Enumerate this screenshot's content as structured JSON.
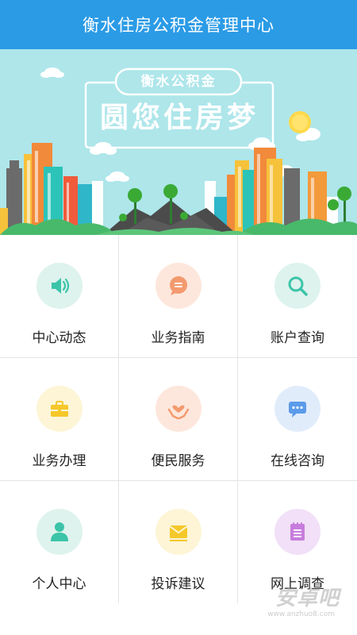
{
  "header": {
    "title": "衡水住房公积金管理中心"
  },
  "banner": {
    "tag": "衡水公积金",
    "slogan": "圆您住房梦"
  },
  "grid": {
    "items": [
      {
        "label": "中心动态",
        "icon": "speaker-icon",
        "bg": "#def3ee",
        "color": "#3cc4a8"
      },
      {
        "label": "业务指南",
        "icon": "chat-bubble-icon",
        "bg": "#fde7dc",
        "color": "#f39a6e"
      },
      {
        "label": "账户查询",
        "icon": "search-icon",
        "bg": "#def3ee",
        "color": "#3cc4a8"
      },
      {
        "label": "业务办理",
        "icon": "briefcase-icon",
        "bg": "#fdf5d6",
        "color": "#f5c82a"
      },
      {
        "label": "便民服务",
        "icon": "heart-hands-icon",
        "bg": "#fde7dc",
        "color": "#f39a6e"
      },
      {
        "label": "在线咨询",
        "icon": "message-icon",
        "bg": "#e1ecfb",
        "color": "#5b9bea"
      },
      {
        "label": "个人中心",
        "icon": "person-icon",
        "bg": "#def3ee",
        "color": "#3cc4a8"
      },
      {
        "label": "投诉建议",
        "icon": "envelope-icon",
        "bg": "#fdf5d6",
        "color": "#f5c82a"
      },
      {
        "label": "网上调查",
        "icon": "notepad-icon",
        "bg": "#f1e0f7",
        "color": "#c77ddd"
      }
    ]
  },
  "watermark": {
    "text": "安卓吧",
    "sub": "www.anzhuo8.com"
  }
}
